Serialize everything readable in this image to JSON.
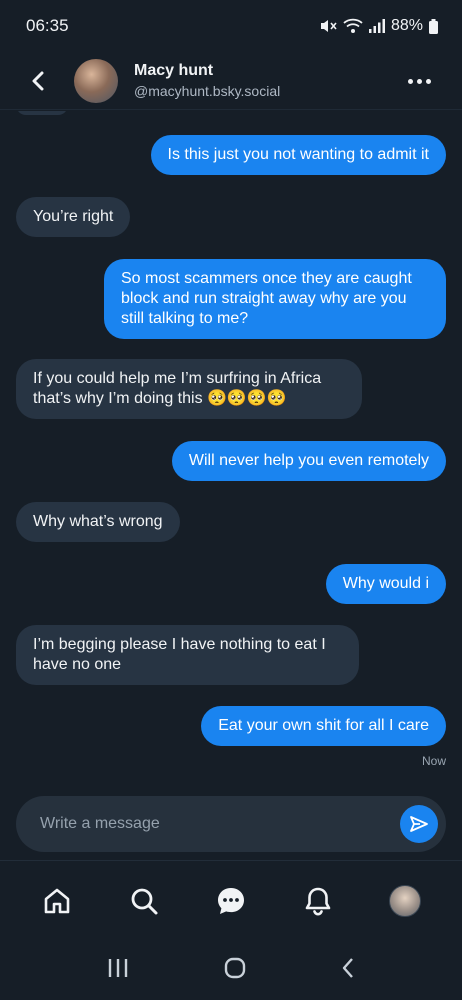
{
  "status_bar": {
    "time": "06:35",
    "battery": "88%"
  },
  "header": {
    "name": "Macy hunt",
    "handle": "@macyhunt.bsky.social"
  },
  "messages": [
    {
      "side": "out",
      "text": "Is this just you not wanting to admit it"
    },
    {
      "side": "in",
      "text": "You’re right"
    },
    {
      "side": "out",
      "text": "So most scammers once they are caught block and run straight away why are you still talking to me?"
    },
    {
      "side": "in",
      "text": "If you could help me I’m surfring in Africa that’s why I’m doing this 🥺🥺🥺🥺"
    },
    {
      "side": "out",
      "text": "Will never help you even remotely"
    },
    {
      "side": "in",
      "text": "Why what’s wrong"
    },
    {
      "side": "out",
      "text": "Why would i"
    },
    {
      "side": "in",
      "text": "I’m begging please I have nothing to eat I have no one"
    },
    {
      "side": "out",
      "text": "Eat your own shit for all I care"
    }
  ],
  "last_timestamp": "Now",
  "composer": {
    "placeholder": "Write a message"
  },
  "tabs": [
    "home-icon",
    "search-icon",
    "chat-icon",
    "bell-icon",
    "profile-avatar"
  ],
  "colors": {
    "background": "#161e27",
    "incoming": "#273443",
    "outgoing": "#1a84f0",
    "accent": "#1a84f0"
  }
}
